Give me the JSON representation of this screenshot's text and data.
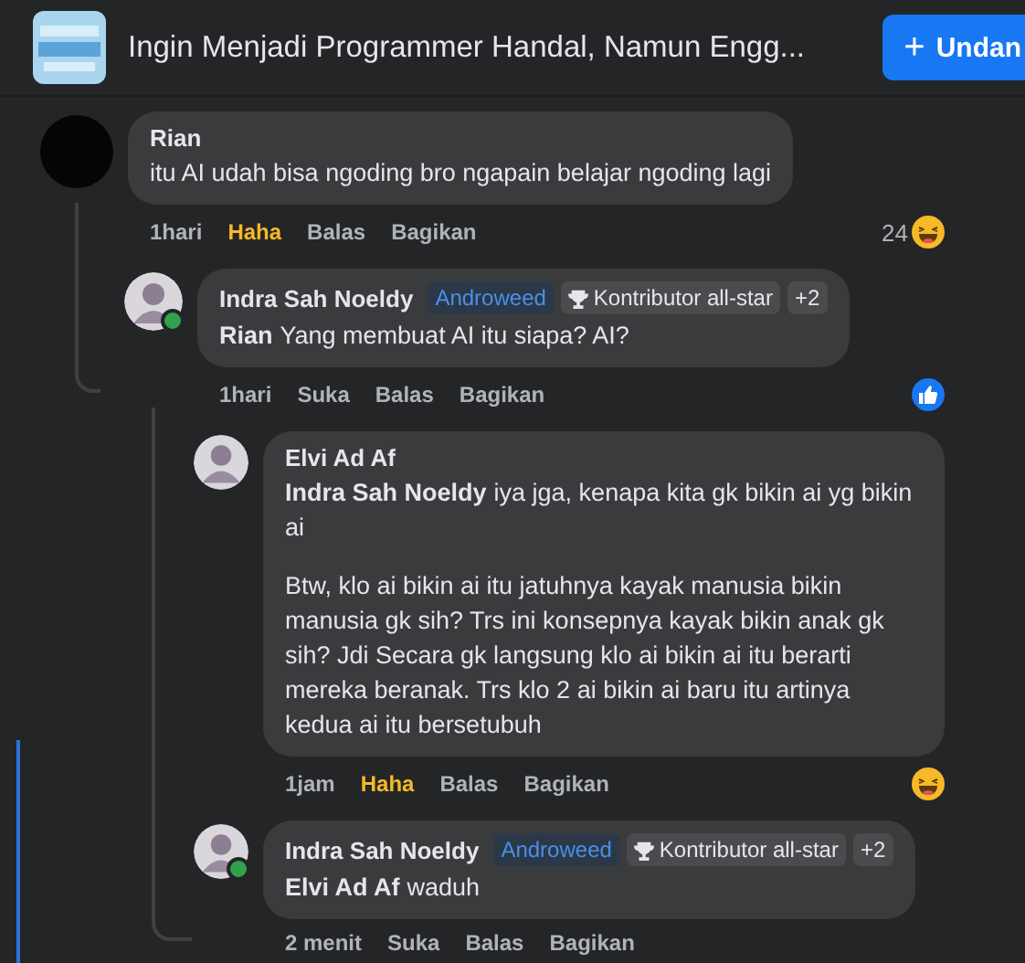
{
  "header": {
    "title": "Ingin Menjadi Programmer Handal, Namun Engg...",
    "invite_button": {
      "icon": "+",
      "label": "Undan"
    }
  },
  "comments": [
    {
      "author": "Rian",
      "avatar": {
        "kind": "dark"
      },
      "online": false,
      "text": "itu AI udah bisa ngoding bro ngapain belajar ngoding lagi",
      "time": "1hari",
      "reaction": {
        "label": "Haha",
        "selected": true
      },
      "reply": "Balas",
      "share": "Bagikan",
      "reaction_icon": {
        "kind": "haha"
      },
      "reaction_count": "24",
      "children": [
        {
          "author": "Indra Sah Noeldy",
          "avatar": {
            "kind": "photo"
          },
          "online": true,
          "badges": [
            {
              "kind": "group",
              "label": "Androweed"
            },
            {
              "kind": "award",
              "label": "Kontributor all-star"
            },
            {
              "kind": "more",
              "label": "+2"
            }
          ],
          "mention": "Rian",
          "text": "Yang membuat AI itu siapa? AI?",
          "time": "1hari",
          "reaction": {
            "label": "Suka",
            "selected": false
          },
          "reply": "Balas",
          "share": "Bagikan",
          "reaction_icon": {
            "kind": "like"
          },
          "children": [
            {
              "author": "Elvi Ad Af",
              "avatar": {
                "kind": "photo"
              },
              "online": false,
              "mention": "Indra Sah Noeldy",
              "text": "iya jga, kenapa kita gk bikin ai yg bikin ai",
              "paragraphs": [
                "Btw, klo ai bikin ai itu jatuhnya kayak manusia bikin manusia gk sih? Trs ini konsepnya kayak bikin anak gk sih? Jdi Secara gk langsung klo ai bikin ai itu berarti mereka beranak. Trs klo 2 ai bikin ai baru itu artinya kedua ai itu bersetubuh"
              ],
              "time": "1jam",
              "reaction": {
                "label": "Haha",
                "selected": true
              },
              "reply": "Balas",
              "share": "Bagikan",
              "reaction_icon": {
                "kind": "haha"
              }
            },
            {
              "author": "Indra Sah Noeldy",
              "avatar": {
                "kind": "photo"
              },
              "online": true,
              "badges": [
                {
                  "kind": "group",
                  "label": "Androweed"
                },
                {
                  "kind": "award",
                  "label": "Kontributor all-star"
                },
                {
                  "kind": "more",
                  "label": "+2"
                }
              ],
              "mention": "Elvi Ad Af",
              "text": "waduh",
              "time": "2 menit",
              "reaction": {
                "label": "Suka",
                "selected": false
              },
              "reply": "Balas",
              "share": "Bagikan"
            }
          ]
        }
      ]
    }
  ]
}
